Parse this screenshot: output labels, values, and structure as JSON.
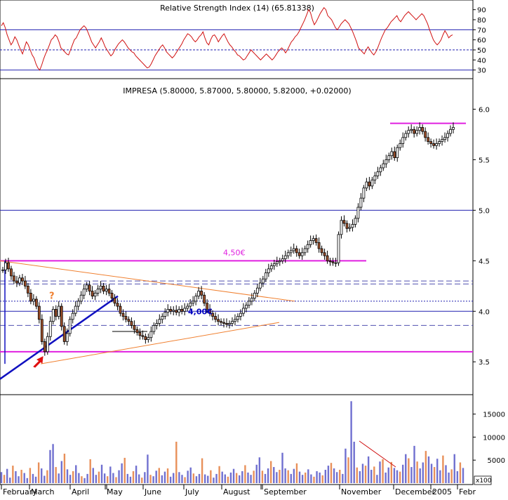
{
  "chart_data": [
    {
      "type": "line",
      "panel": "indicator",
      "title": "Relative Strength Index (14) (65.81338)",
      "y_ticks": [
        30,
        40,
        50,
        60,
        70,
        80,
        90
      ],
      "ylim": [
        27,
        94
      ],
      "levels": {
        "solid": [
          30,
          70
        ],
        "dashed": [
          50
        ]
      },
      "series": [
        {
          "values": [
            74,
            77,
            72,
            65,
            60,
            55,
            58,
            63,
            60,
            55,
            50,
            46,
            52,
            58,
            55,
            50,
            45,
            42,
            36,
            32,
            30,
            35,
            41,
            46,
            50,
            55,
            60,
            62,
            65,
            63,
            58,
            52,
            50,
            48,
            46,
            45,
            50,
            55,
            60,
            62,
            66,
            70,
            72,
            74,
            72,
            68,
            63,
            58,
            55,
            52,
            55,
            58,
            62,
            58,
            53,
            50,
            47,
            44,
            46,
            50,
            53,
            56,
            58,
            60,
            58,
            55,
            52,
            50,
            48,
            47,
            44,
            42,
            40,
            38,
            36,
            34,
            32,
            33,
            36,
            40,
            44,
            47,
            50,
            53,
            55,
            52,
            48,
            46,
            44,
            42,
            44,
            47,
            50,
            53,
            56,
            60,
            63,
            66,
            65,
            63,
            60,
            58,
            60,
            63,
            65,
            68,
            62,
            57,
            55,
            60,
            64,
            65,
            62,
            58,
            61,
            64,
            66,
            62,
            58,
            55,
            53,
            50,
            48,
            45,
            44,
            42,
            40,
            41,
            44,
            47,
            50,
            48,
            46,
            44,
            42,
            40,
            42,
            44,
            46,
            44,
            42,
            40,
            42,
            45,
            48,
            50,
            52,
            50,
            47,
            50,
            54,
            58,
            60,
            63,
            65,
            68,
            72,
            76,
            80,
            85,
            90,
            87,
            80,
            75,
            78,
            82,
            86,
            89,
            92,
            90,
            84,
            82,
            80,
            76,
            72,
            70,
            73,
            76,
            78,
            80,
            78,
            76,
            72,
            68,
            63,
            58,
            52,
            50,
            48,
            46,
            50,
            53,
            50,
            47,
            45,
            48,
            52,
            57,
            62,
            66,
            70,
            72,
            75,
            78,
            80,
            82,
            84,
            80,
            78,
            81,
            84,
            86,
            88,
            86,
            84,
            82,
            80,
            82,
            84,
            86,
            84,
            80,
            76,
            70,
            65,
            60,
            57,
            55,
            57,
            60,
            65,
            69,
            66,
            62,
            64,
            65
          ]
        }
      ]
    },
    {
      "type": "candlestick",
      "panel": "price",
      "title": "IMPRESA (5.80000, 5.87000, 5.80000, 5.82000, +0.02000)",
      "y_ticks": [
        "3.5",
        "4.0",
        "4.5",
        "5.0",
        "5.5",
        "6.0"
      ],
      "ylim": [
        3.3,
        6.08
      ],
      "values": [
        4.41,
        4.48,
        4.42,
        4.35,
        4.3,
        4.28,
        4.33,
        4.3,
        4.25,
        4.18,
        4.1,
        4.12,
        4.05,
        3.92,
        3.7,
        3.6,
        3.75,
        3.9,
        4.02,
        3.95,
        4.05,
        3.85,
        3.7,
        3.78,
        3.92,
        3.98,
        4.05,
        4.1,
        4.16,
        4.22,
        4.26,
        4.2,
        4.15,
        4.18,
        4.22,
        4.25,
        4.2,
        4.22,
        4.18,
        4.13,
        4.08,
        4.05,
        3.98,
        3.95,
        3.92,
        3.9,
        3.86,
        3.82,
        3.79,
        3.76,
        3.75,
        3.72,
        3.74,
        3.8,
        3.86,
        3.88,
        3.92,
        3.95,
        3.99,
        4.02,
        4.0,
        4.01,
        3.99,
        4.02,
        4.0,
        4.03,
        4.05,
        4.08,
        4.1,
        4.15,
        4.2,
        4.16,
        4.08,
        4.02,
        3.98,
        3.95,
        3.92,
        3.9,
        3.89,
        3.88,
        3.87,
        3.88,
        3.9,
        3.92,
        3.95,
        3.98,
        4.03,
        4.06,
        4.1,
        4.13,
        4.18,
        4.23,
        4.28,
        4.32,
        4.38,
        4.42,
        4.45,
        4.47,
        4.49,
        4.5,
        4.52,
        4.55,
        4.58,
        4.6,
        4.62,
        4.58,
        4.55,
        4.58,
        4.62,
        4.66,
        4.7,
        4.72,
        4.68,
        4.62,
        4.58,
        4.55,
        4.5,
        4.49,
        4.48,
        4.48,
        4.76,
        4.9,
        4.87,
        4.82,
        4.83,
        4.86,
        4.92,
        5.03,
        5.12,
        5.22,
        5.28,
        5.24,
        5.3,
        5.34,
        5.38,
        5.42,
        5.46,
        5.5,
        5.54,
        5.58,
        5.52,
        5.62,
        5.66,
        5.72,
        5.76,
        5.79,
        5.8,
        5.76,
        5.79,
        5.82,
        5.78,
        5.72,
        5.68,
        5.66,
        5.64,
        5.66,
        5.68,
        5.7,
        5.72,
        5.76,
        5.8,
        5.82
      ],
      "annotations": [
        {
          "text": "4,50€",
          "y": 4.5,
          "color": "#e020e0"
        },
        {
          "text": "4,00€",
          "y": 4.0,
          "color": "#0000c0"
        },
        {
          "text": "?",
          "y": 4.15,
          "color": "#f08030"
        }
      ],
      "levels": {
        "magenta": [
          4.5,
          3.6
        ],
        "solid": [
          5.0,
          4.0
        ],
        "dashed": [
          4.3,
          4.27,
          3.86
        ],
        "dotted": [
          4.1
        ]
      }
    },
    {
      "type": "bar",
      "panel": "volume",
      "title": "Volume (×100)",
      "y_unit": "x100",
      "y_ticks": [
        "5000",
        "10000",
        "15000"
      ],
      "ylim": [
        0,
        18000
      ],
      "values": [
        2400,
        1800,
        3100,
        1200,
        3800,
        2600,
        1500,
        2900,
        2200,
        1100,
        3300,
        2000,
        1400,
        4500,
        3200,
        1600,
        2800,
        7200,
        8500,
        3500,
        2100,
        4800,
        6400,
        3000,
        1800,
        2600,
        3900,
        2200,
        1500,
        1100,
        2000,
        5200,
        3300,
        1800,
        2500,
        4000,
        2100,
        1500,
        3600,
        2200,
        1300,
        2800,
        4300,
        5500,
        2000,
        1400,
        2600,
        3800,
        1900,
        1200,
        2400,
        6200,
        1800,
        1500,
        2700,
        3300,
        1700,
        2500,
        3200,
        1400,
        2200,
        9000,
        2400,
        1800,
        1300,
        2700,
        3400,
        2100,
        1500,
        2000,
        5400,
        1900,
        1600,
        2800,
        1200,
        2000,
        3700,
        2500,
        1900,
        1400,
        2300,
        3100,
        2200,
        1700,
        2600,
        3900,
        2300,
        1800,
        2700,
        4000,
        5600,
        2700,
        2000,
        3200,
        4800,
        3500,
        2400,
        2900,
        6600,
        3200,
        2800,
        2000,
        3100,
        4300,
        2500,
        1800,
        2300,
        3000,
        1900,
        1400,
        2600,
        2300,
        1700,
        2900,
        3800,
        4400,
        3200,
        2400,
        2900,
        2000,
        7500,
        5600,
        17800,
        9000,
        3400,
        2600,
        4200,
        3800,
        5800,
        2900,
        3600,
        1800,
        4700,
        5200,
        2300,
        3400,
        4600,
        3300,
        2800,
        2500,
        4000,
        6300,
        5400,
        3500,
        8100,
        4700,
        3200,
        4500,
        7000,
        5800,
        4200,
        3500,
        5300,
        2800,
        6000,
        3900,
        2300,
        3000,
        6300,
        2600,
        4500,
        3300
      ]
    }
  ],
  "x_axis": {
    "months": [
      "February",
      "March",
      "April",
      "May",
      "June",
      "July",
      "August",
      "September",
      "November",
      "December",
      "2005",
      "Febr"
    ]
  }
}
